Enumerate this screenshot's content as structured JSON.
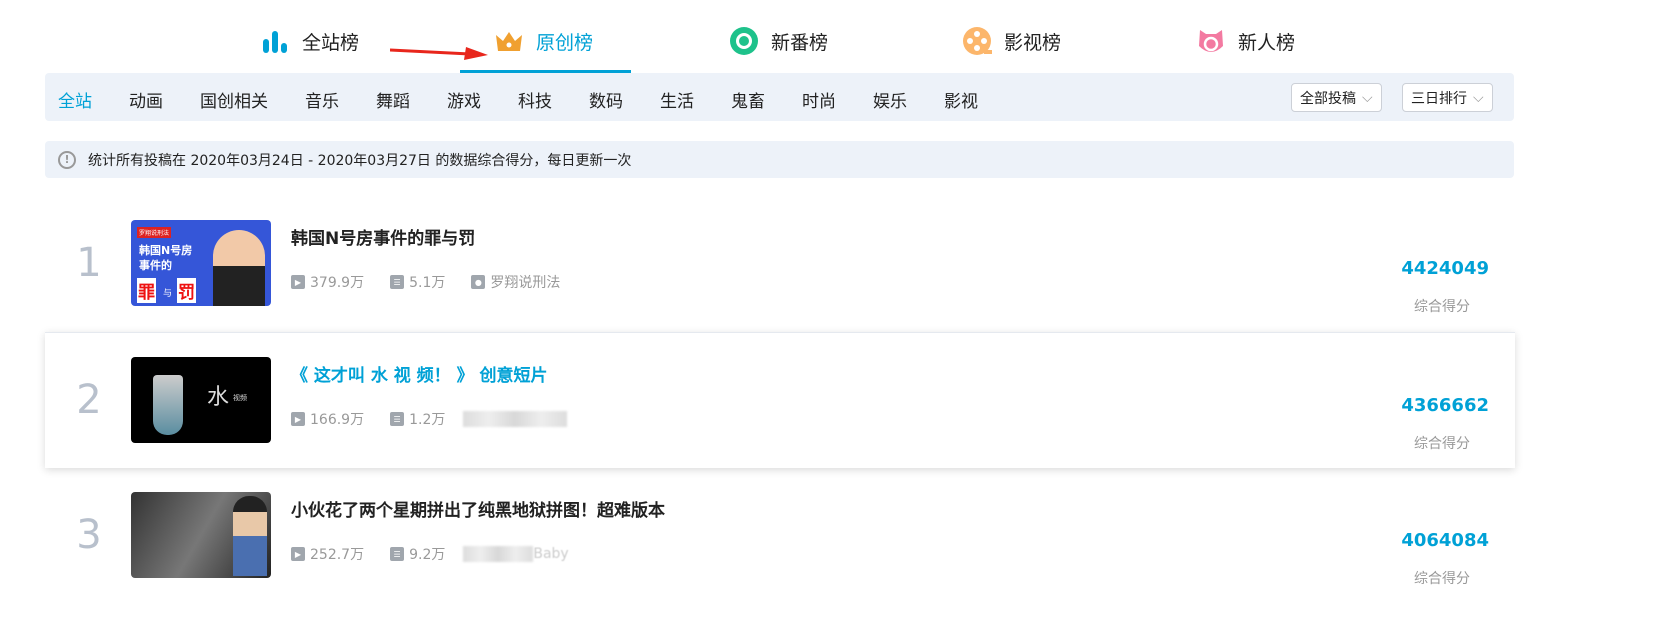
{
  "tabs": [
    {
      "label": "全站榜",
      "icon": "bar-chart-icon"
    },
    {
      "label": "原创榜",
      "icon": "crown-icon"
    },
    {
      "label": "新番榜",
      "icon": "ring-icon"
    },
    {
      "label": "影视榜",
      "icon": "film-reel-icon"
    },
    {
      "label": "新人榜",
      "icon": "new-user-icon"
    }
  ],
  "active_tab": "原创榜",
  "categories": [
    "全站",
    "动画",
    "国创相关",
    "音乐",
    "舞蹈",
    "游戏",
    "科技",
    "数码",
    "生活",
    "鬼畜",
    "时尚",
    "娱乐",
    "影视"
  ],
  "filters": {
    "type": "全部投稿",
    "period": "三日排行"
  },
  "notice": "统计所有投稿在 2020年03月24日 - 2020年03月27日 的数据综合得分，每日更新一次",
  "score_label": "综合得分",
  "items": [
    {
      "rank": "1",
      "title": "韩国N号房事件的罪与罚",
      "plays": "379.9万",
      "danmaku": "5.1万",
      "author": "罗翔说刑法",
      "score": "4424049",
      "thumb_text": [
        "罗翔说刑法",
        "韩国N号房",
        "事件的",
        "罪",
        "与",
        "罚"
      ]
    },
    {
      "rank": "2",
      "title": "《 这才叫 水 视 频！ 》 创意短片",
      "plays": "166.9万",
      "danmaku": "1.2万",
      "author": "",
      "score": "4366662",
      "thumb_text": [
        "水",
        "视频"
      ]
    },
    {
      "rank": "3",
      "title": "小伙花了两个星期拼出了纯黑地狱拼图！超难版本",
      "plays": "252.7万",
      "danmaku": "9.2万",
      "author": "Baby",
      "score": "4064084"
    }
  ],
  "colors": {
    "accent": "#00a1d6",
    "rank": "#b8c0cc",
    "bar": "#edf2f9"
  }
}
